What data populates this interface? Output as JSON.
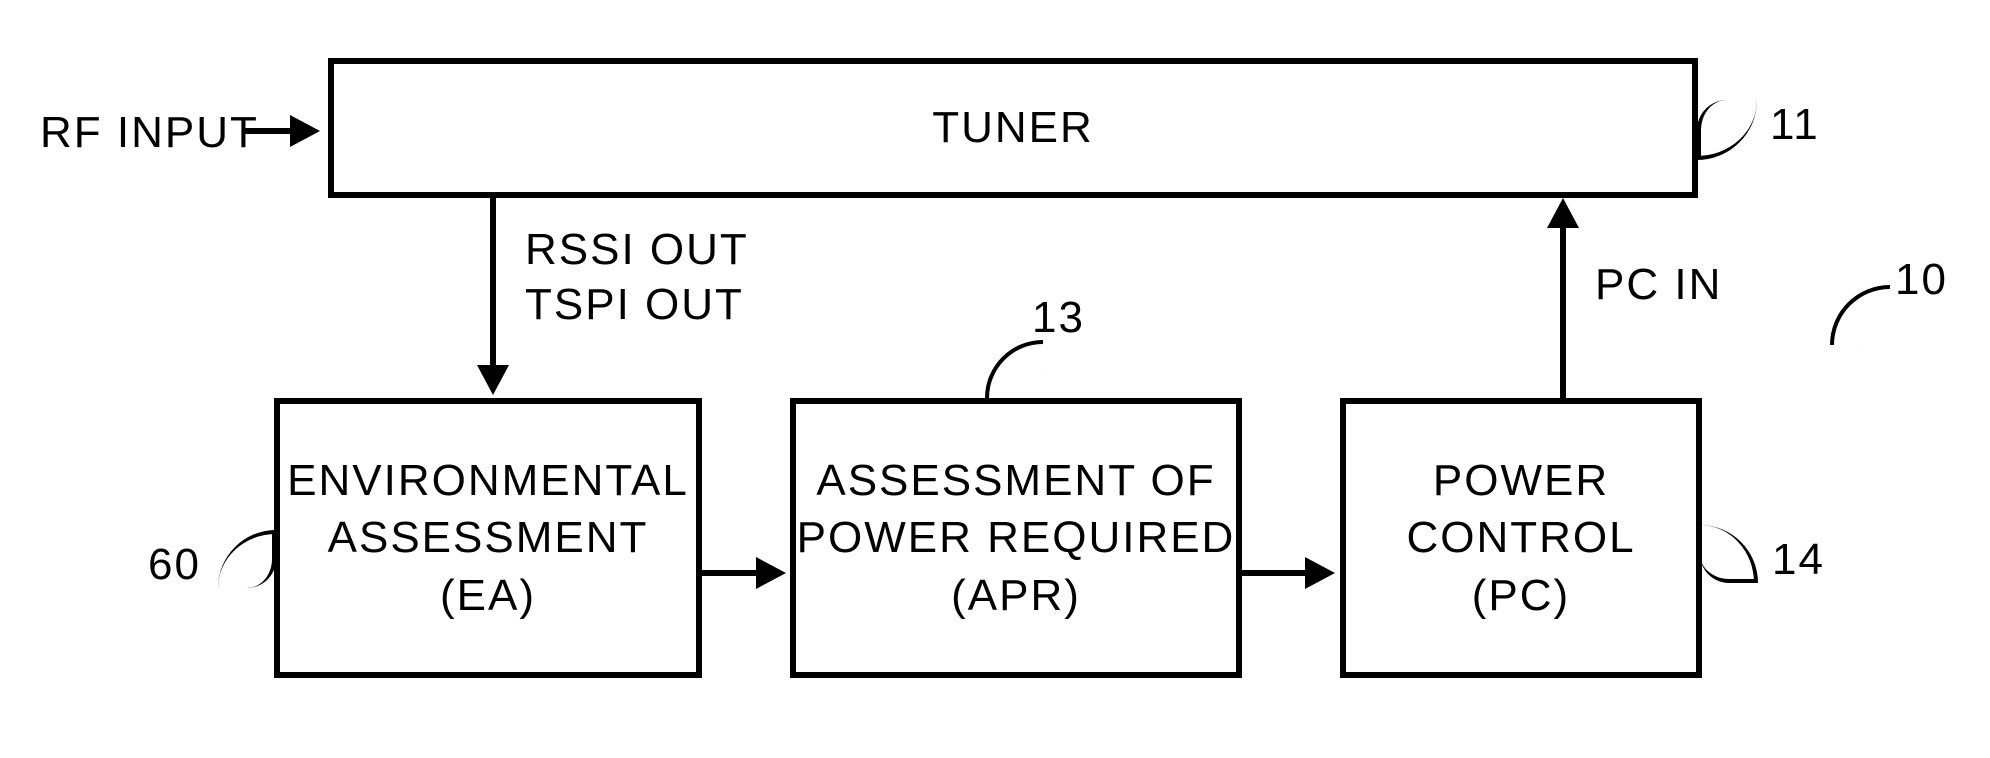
{
  "inputs": {
    "rf": "RF INPUT"
  },
  "tuner": {
    "label": "TUNER",
    "ref": "11"
  },
  "signals": {
    "rssi": "RSSI OUT",
    "tspi": "TSPI OUT",
    "pcin": "PC IN"
  },
  "ea": {
    "line1": "ENVIRONMENTAL",
    "line2": "ASSESSMENT",
    "line3": "(EA)",
    "ref": "60"
  },
  "apr": {
    "line1": "ASSESSMENT OF",
    "line2": "POWER REQUIRED",
    "line3": "(APR)",
    "ref": "13"
  },
  "pc": {
    "line1": "POWER",
    "line2": "CONTROL",
    "line3": "(PC)",
    "ref": "14"
  },
  "system": {
    "ref": "10"
  }
}
